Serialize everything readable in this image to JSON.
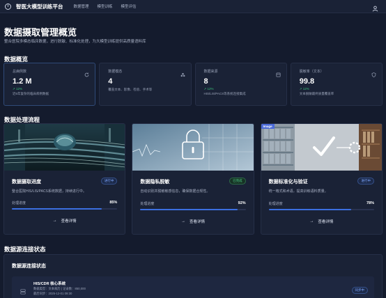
{
  "header": {
    "app_title": "智医大模型训练平台",
    "nav": [
      "数据管理",
      "模型训练",
      "模型评估"
    ]
  },
  "hero": {
    "title": "数据摄取管理概览",
    "subtitle": "整合医院多模态临床数据，进行脱敏、标准化处理，为大模型训练提供高质量语料库"
  },
  "overview": {
    "section_title": "数据概览",
    "stats": [
      {
        "label": "总病例数",
        "value": "1.2 M",
        "trend": "↗ 12%",
        "note": "近5年复杂的临床病例数据",
        "icon": "refresh-icon"
      },
      {
        "label": "数据模态",
        "value": "4",
        "trend": "",
        "note": "覆盖文本、影像、检验、手术等",
        "icon": "layers-icon"
      },
      {
        "label": "数据来源",
        "value": "8",
        "trend": "↗ 12%",
        "note": "HIS/LIS/PACS等系统连接集成",
        "icon": "database-icon"
      },
      {
        "label": "脱敏率（文本）",
        "value": "99.8",
        "trend": "↗ 12%",
        "note": "文本脱敏最终质量覆盖率",
        "icon": "shield-icon"
      }
    ]
  },
  "process": {
    "section_title": "数据处理流程",
    "cards": [
      {
        "title": "数据摄取进度",
        "desc": "整合医院HIS/LIS/PACS系统数据，持续进行中。",
        "status": "进行中",
        "progress_label": "处理进度",
        "progress_value": "85%",
        "progress": 0.85,
        "detail_label": "查看详情"
      },
      {
        "title": "数据隐私脱敏",
        "desc": "自动识别并脱敏敏感信息，确保数据合规性。",
        "status": "已完成",
        "progress_label": "处理进度",
        "progress_value": "92%",
        "progress": 0.92,
        "detail_label": "查看详情"
      },
      {
        "title": "数据标准化与验证",
        "desc": "统一格式和术语，提高训练语料质量。",
        "status": "进行中",
        "progress_label": "处理进度",
        "progress_value": "78%",
        "progress": 0.78,
        "detail_label": "查看详情",
        "image_tag": "Image"
      }
    ]
  },
  "sources": {
    "section_title": "数据源连接状态",
    "panel_title": "数据源连接状态",
    "items": [
      {
        "name": "HIS/CDR 核心系统",
        "meta": "数据类型：文本病历 | 记录数：850,000",
        "sync": "最后同步：2025-12-01 09:30",
        "status": "同步中"
      }
    ]
  },
  "colors": {
    "accent": "#3b6fe0",
    "success": "#39c27a",
    "background": "#141b2d",
    "card": "#1a2236"
  }
}
